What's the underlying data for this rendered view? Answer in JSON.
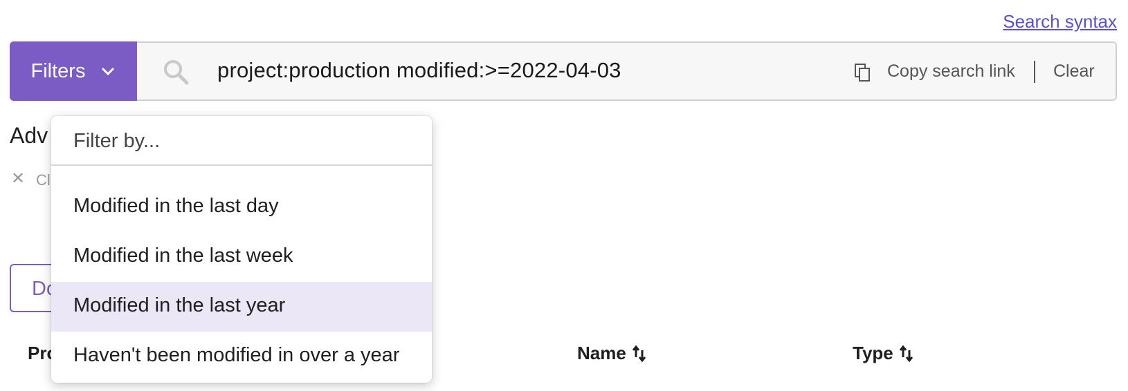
{
  "header": {
    "syntax_link": "Search syntax"
  },
  "search": {
    "filters_label": "Filters",
    "query": "project:production modified:>=2022-04-03",
    "copy_link_label": "Copy search link",
    "clear_label": "Clear"
  },
  "background": {
    "advanced_heading_partial": "Adv",
    "clear_partial": "Cl",
    "button_partial": "Do",
    "columns": {
      "col1_partial": "Pro",
      "name": "Name",
      "type": "Type"
    }
  },
  "dropdown": {
    "filter_placeholder": "Filter by...",
    "items": [
      {
        "label": "Modified in the last day"
      },
      {
        "label": "Modified in the last week"
      },
      {
        "label": "Modified in the last year"
      },
      {
        "label": "Haven't been modified in over a year"
      }
    ],
    "selected_index": 2
  },
  "colors": {
    "accent": "#7b5cc4",
    "link": "#5a4fcf",
    "selected_row": "#ebe7f6"
  },
  "icons": [
    "chevron-down-icon",
    "search-icon",
    "copy-icon",
    "close-icon",
    "sort-icon"
  ]
}
